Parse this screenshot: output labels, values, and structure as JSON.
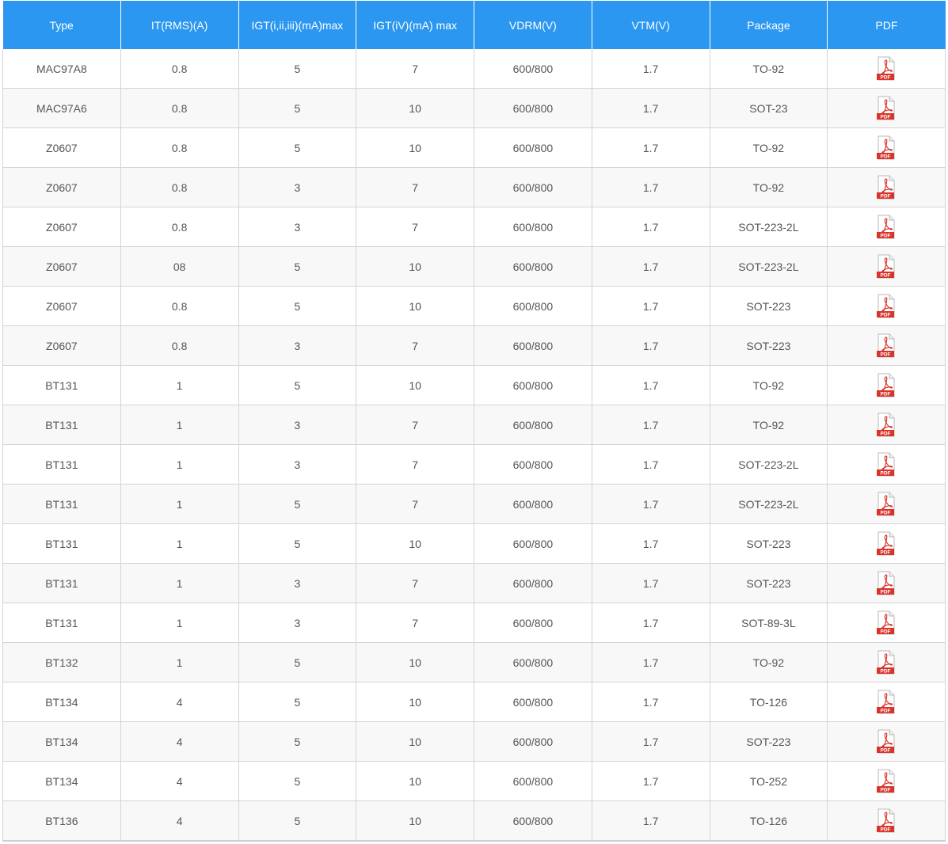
{
  "table": {
    "headers": [
      "Type",
      "IT(RMS)(A)",
      "IGT(i,ii,iii)(mA)max",
      "IGT(iV)(mA) max",
      "VDRM(V)",
      "VTM(V)",
      "Package",
      "PDF"
    ],
    "pdf_icon_label": "PDF",
    "pdf_icon": "pdf-file-icon",
    "accent_color": "#2b97f0",
    "pdf_icon_color": "#d9342b",
    "rows": [
      [
        "MAC97A8",
        "0.8",
        "5",
        "7",
        "600/800",
        "1.7",
        "TO-92"
      ],
      [
        "MAC97A6",
        "0.8",
        "5",
        "10",
        "600/800",
        "1.7",
        "SOT-23"
      ],
      [
        "Z0607",
        "0.8",
        "5",
        "10",
        "600/800",
        "1.7",
        "TO-92"
      ],
      [
        "Z0607",
        "0.8",
        "3",
        "7",
        "600/800",
        "1.7",
        "TO-92"
      ],
      [
        "Z0607",
        "0.8",
        "3",
        "7",
        "600/800",
        "1.7",
        "SOT-223-2L"
      ],
      [
        "Z0607",
        "08",
        "5",
        "10",
        "600/800",
        "1.7",
        "SOT-223-2L"
      ],
      [
        "Z0607",
        "0.8",
        "5",
        "10",
        "600/800",
        "1.7",
        "SOT-223"
      ],
      [
        "Z0607",
        "0.8",
        "3",
        "7",
        "600/800",
        "1.7",
        "SOT-223"
      ],
      [
        "BT131",
        "1",
        "5",
        "10",
        "600/800",
        "1.7",
        "TO-92"
      ],
      [
        "BT131",
        "1",
        "3",
        "7",
        "600/800",
        "1.7",
        "TO-92"
      ],
      [
        "BT131",
        "1",
        "3",
        "7",
        "600/800",
        "1.7",
        "SOT-223-2L"
      ],
      [
        "BT131",
        "1",
        "5",
        "7",
        "600/800",
        "1.7",
        "SOT-223-2L"
      ],
      [
        "BT131",
        "1",
        "5",
        "10",
        "600/800",
        "1.7",
        "SOT-223"
      ],
      [
        "BT131",
        "1",
        "3",
        "7",
        "600/800",
        "1.7",
        "SOT-223"
      ],
      [
        "BT131",
        "1",
        "3",
        "7",
        "600/800",
        "1.7",
        "SOT-89-3L"
      ],
      [
        "BT132",
        "1",
        "5",
        "10",
        "600/800",
        "1.7",
        "TO-92"
      ],
      [
        "BT134",
        "4",
        "5",
        "10",
        "600/800",
        "1.7",
        "TO-126"
      ],
      [
        "BT134",
        "4",
        "5",
        "10",
        "600/800",
        "1.7",
        "SOT-223"
      ],
      [
        "BT134",
        "4",
        "5",
        "10",
        "600/800",
        "1.7",
        "TO-252"
      ],
      [
        "BT136",
        "4",
        "5",
        "10",
        "600/800",
        "1.7",
        "TO-126"
      ]
    ]
  }
}
